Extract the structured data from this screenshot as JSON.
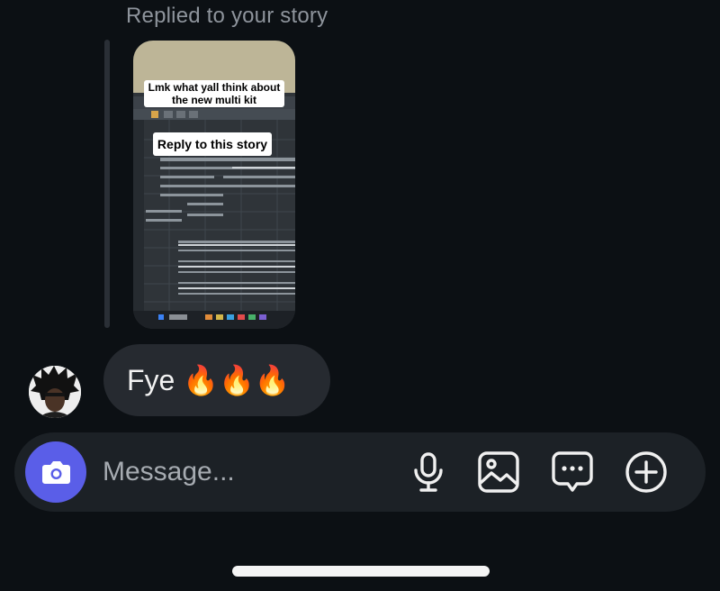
{
  "thread": {
    "replied_label": "Replied to your story"
  },
  "story": {
    "caption_top": "Lmk what yall think about the new multi kit",
    "caption_reply": "Reply to this story"
  },
  "message": {
    "text": "Fye 🔥🔥🔥"
  },
  "composer": {
    "placeholder": "Message..."
  },
  "icons": {
    "camera": "camera-icon",
    "microphone": "microphone-icon",
    "gallery": "image-icon",
    "sticker": "chat-bubble-dots-icon",
    "more": "plus-circle-icon"
  },
  "colors": {
    "background": "#0c1014",
    "bubble": "#262a30",
    "composer": "#1c2126",
    "camera_button": "#5a5ee8",
    "secondary_text": "#8e949c"
  }
}
